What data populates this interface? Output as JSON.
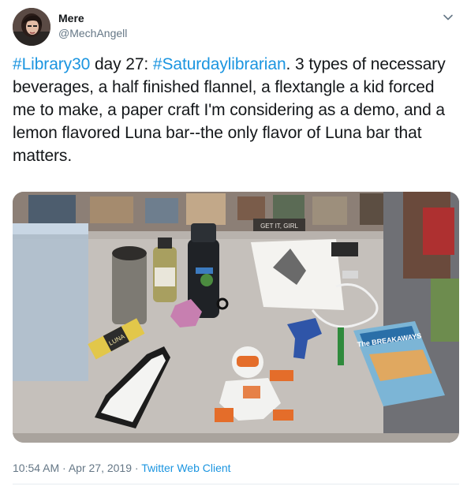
{
  "user": {
    "display_name": "Mere",
    "handle": "@MechAngell"
  },
  "tweet": {
    "hashtag_1": "#Library30",
    "text_1": " day 27: ",
    "hashtag_2": "#Saturdaylibrarian",
    "text_2": ". 3 types of necessary beverages, a half finished flannel, a flextangle a kid forced me to make, a paper craft I'm considering as a demo, and a lemon flavored Luna bar--the only flavor of Luna bar that matters."
  },
  "photo": {
    "sign_text": "GET IT, GIRL",
    "bar_label": "LUNA",
    "book_title": "The BREAKAWAYS"
  },
  "meta": {
    "time": "10:54 AM",
    "separator_1": " · ",
    "date": "Apr 27, 2019",
    "separator_2": " · ",
    "client": "Twitter Web Client"
  },
  "icons": {
    "caret": "chevron-down-icon"
  },
  "colors": {
    "link": "#1b95e0",
    "secondary_text": "#657786",
    "primary_text": "#14171a"
  }
}
